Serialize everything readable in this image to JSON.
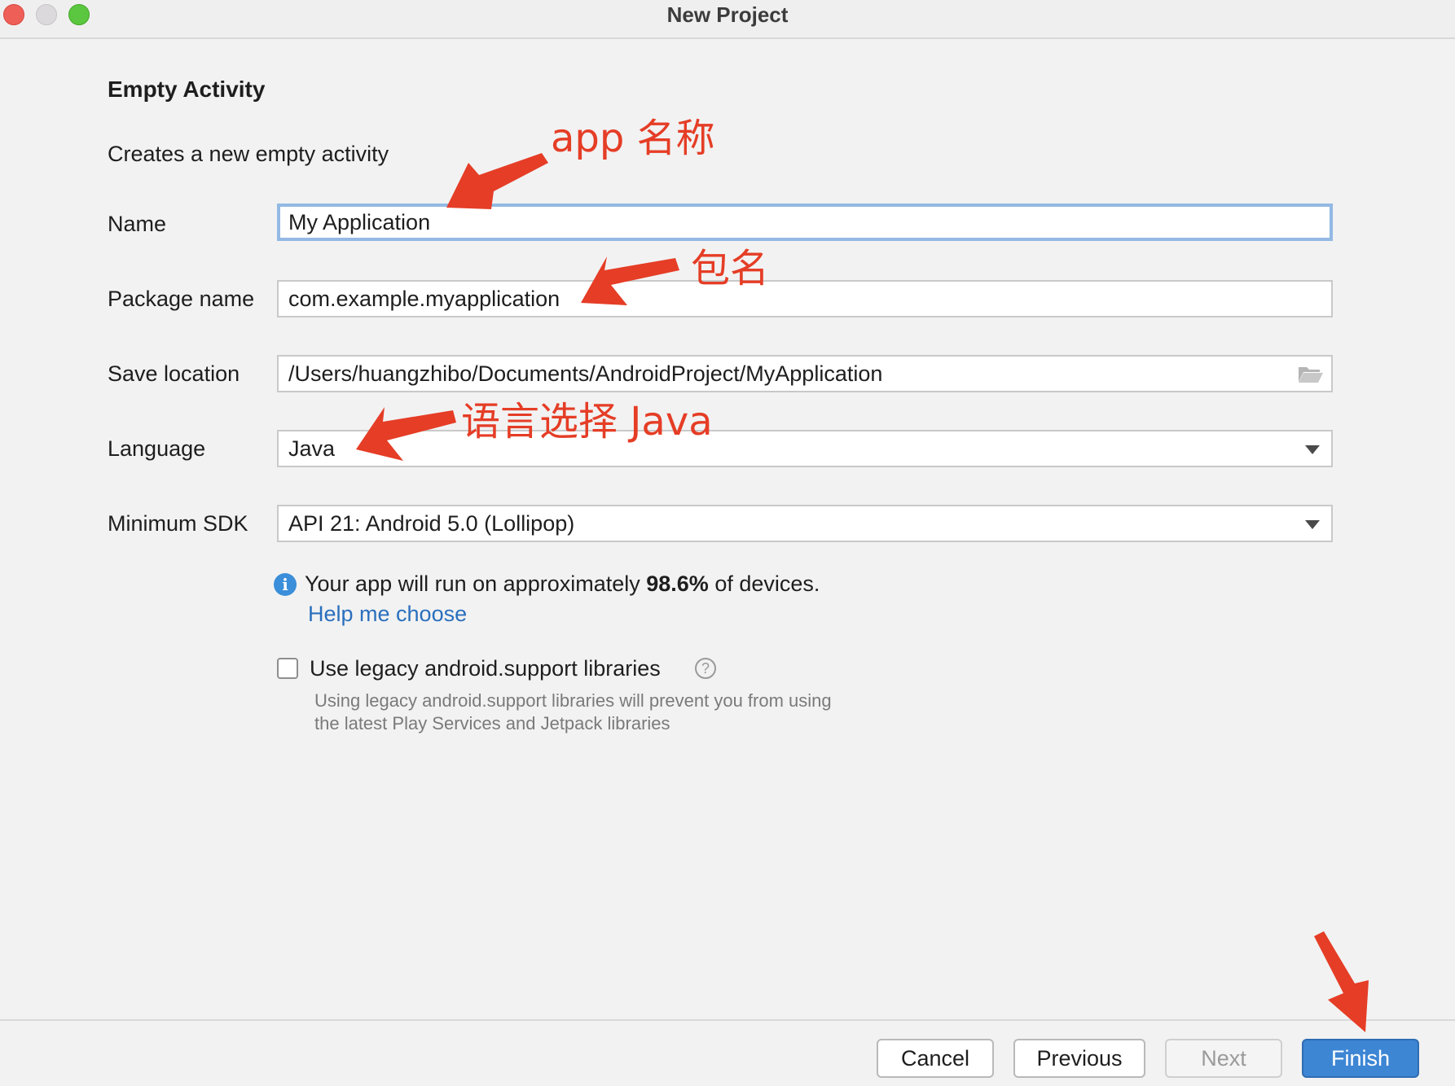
{
  "window": {
    "title": "New Project"
  },
  "page": {
    "heading": "Empty Activity",
    "subheading": "Creates a new empty activity"
  },
  "form": {
    "name": {
      "label": "Name",
      "value": "My Application"
    },
    "package": {
      "label": "Package name",
      "value": "com.example.myapplication"
    },
    "location": {
      "label": "Save location",
      "value": "/Users/huangzhibo/Documents/AndroidProject/MyApplication"
    },
    "language": {
      "label": "Language",
      "value": "Java"
    },
    "min_sdk": {
      "label": "Minimum SDK",
      "value": "API 21: Android 5.0 (Lollipop)"
    }
  },
  "info": {
    "prefix": "Your app will run on approximately ",
    "percent": "98.6%",
    "suffix": " of devices.",
    "link": "Help me choose"
  },
  "legacy": {
    "label": "Use legacy android.support libraries",
    "checked": false,
    "hint_line1": "Using legacy android.support libraries will prevent you from using",
    "hint_line2": "the latest Play Services and Jetpack libraries"
  },
  "buttons": {
    "cancel": "Cancel",
    "previous": "Previous",
    "next": "Next",
    "finish": "Finish"
  },
  "annotations": {
    "app_name": "app 名称",
    "package_name": "包名",
    "language": "语言选择 Java"
  },
  "colors": {
    "accent": "#3d86d4",
    "annotation": "#e53d26",
    "link": "#2a6fbd"
  },
  "icons": {
    "folder": "folder-icon",
    "dropdown": "chevron-down-icon",
    "info": "info-icon",
    "help": "help-icon"
  }
}
